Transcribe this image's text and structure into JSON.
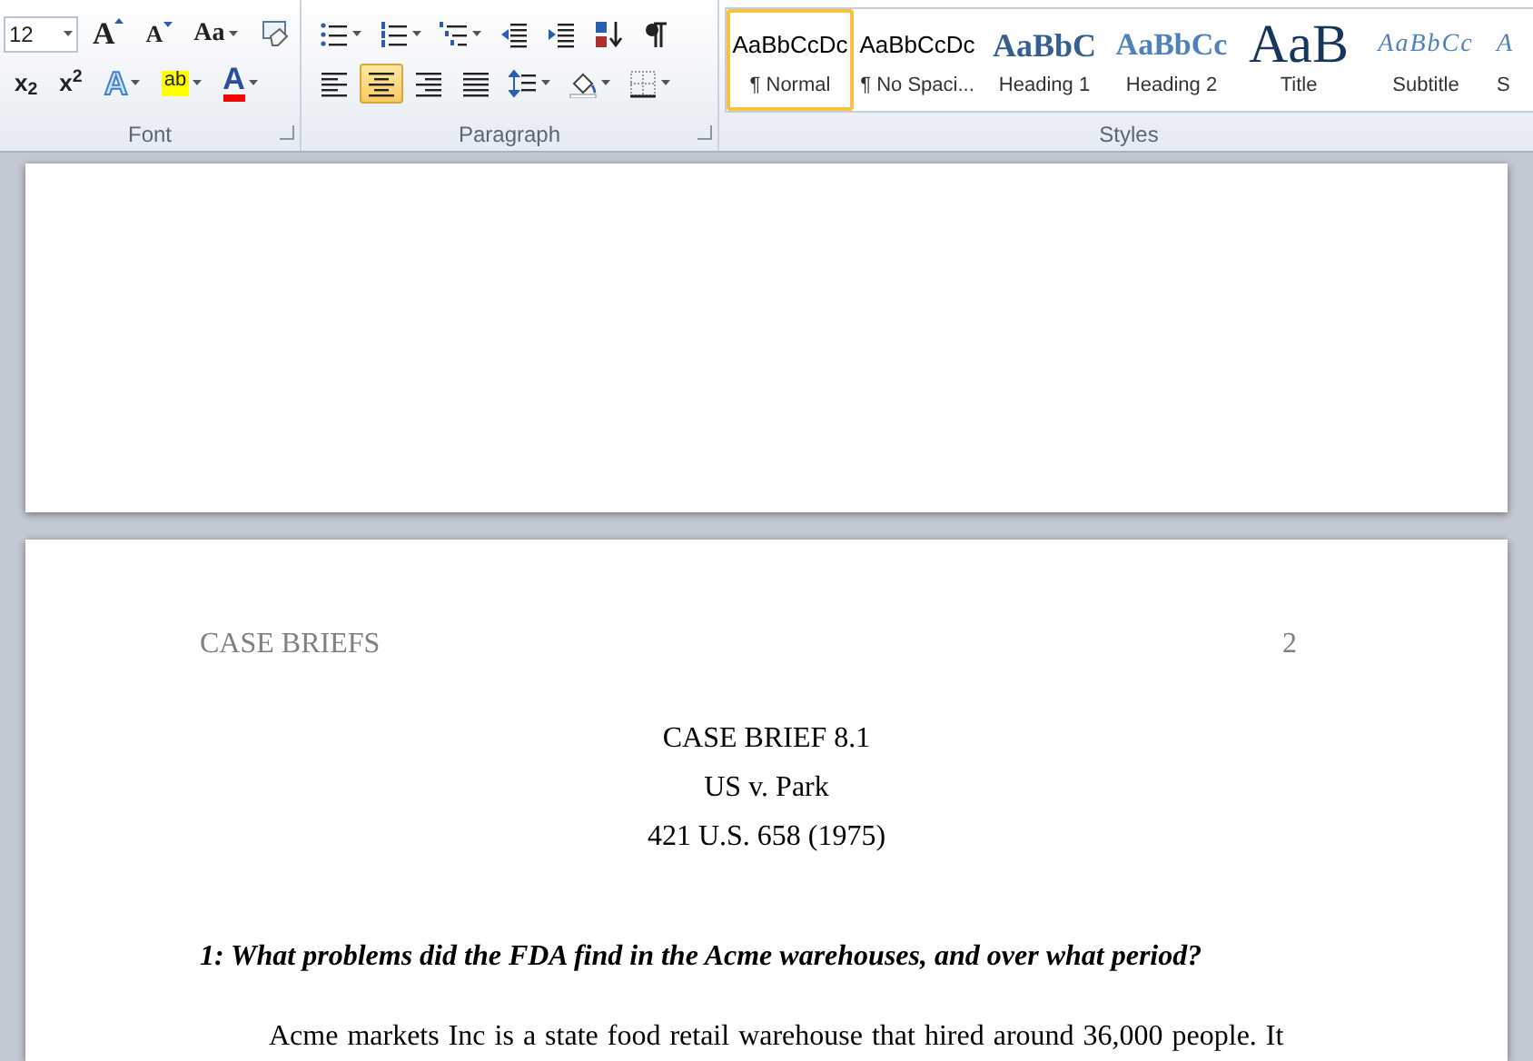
{
  "ribbon": {
    "font_group": {
      "label": "Font",
      "font_size": "12",
      "row1": [
        {
          "kind": "grow",
          "glyph": "A",
          "dropdown": false,
          "selected": false
        },
        {
          "kind": "shrink",
          "glyph": "A",
          "dropdown": false,
          "selected": false
        },
        {
          "kind": "case",
          "glyph": "Aa",
          "dropdown": true,
          "selected": false
        },
        {
          "kind": "clear",
          "dropdown": false,
          "selected": false
        }
      ],
      "row2": [
        {
          "kind": "subscript",
          "glyph": "x$_{2}$",
          "dropdown": false,
          "selected": false
        },
        {
          "kind": "superscript",
          "glyph": "x$^{2}$",
          "dropdown": false,
          "selected": false
        },
        {
          "kind": "effects",
          "glyph": "A",
          "dropdown": true,
          "selected": false
        },
        {
          "kind": "highlight",
          "glyph": "ab",
          "dropdown": true,
          "selected": false
        },
        {
          "kind": "fontcolor",
          "glyph": "A",
          "dropdown": true,
          "selected": false
        }
      ]
    },
    "paragraph_group": {
      "label": "Paragraph",
      "row1": [
        {
          "kind": "bullets",
          "dropdown": true,
          "selected": false
        },
        {
          "kind": "numbering",
          "dropdown": true,
          "selected": false
        },
        {
          "kind": "multilevel",
          "dropdown": true,
          "selected": false
        },
        {
          "kind": "outdent",
          "dropdown": false,
          "selected": false
        },
        {
          "kind": "indent",
          "dropdown": false,
          "selected": false
        },
        {
          "kind": "sort",
          "dropdown": false,
          "selected": false
        },
        {
          "kind": "pilcrow",
          "dropdown": false,
          "selected": false
        }
      ],
      "row2": [
        {
          "kind": "align-left",
          "dropdown": false,
          "selected": false
        },
        {
          "kind": "align-center",
          "dropdown": false,
          "selected": true
        },
        {
          "kind": "align-right",
          "dropdown": false,
          "selected": false
        },
        {
          "kind": "justify",
          "dropdown": false,
          "selected": false
        },
        {
          "kind": "spacing",
          "dropdown": true,
          "selected": false
        },
        {
          "kind": "shading",
          "dropdown": true,
          "selected": false
        },
        {
          "kind": "borders",
          "dropdown": true,
          "selected": false
        }
      ]
    },
    "styles_group": {
      "label": "Styles",
      "styles": [
        {
          "kind": "normal",
          "preview": "AaBbCcDc",
          "label": "¶ Normal",
          "selected": true
        },
        {
          "kind": "normal",
          "preview": "AaBbCcDc",
          "label": "¶ No Spaci...",
          "selected": false
        },
        {
          "kind": "heading1",
          "preview": "AaBbC",
          "label": "Heading 1",
          "selected": false
        },
        {
          "kind": "heading2",
          "preview": "AaBbCc",
          "label": "Heading 2",
          "selected": false
        },
        {
          "kind": "title",
          "preview": "AaB",
          "label": "Title",
          "selected": false
        },
        {
          "kind": "subtitle",
          "preview": "AaBbCc",
          "label": "Subtitle",
          "selected": false
        },
        {
          "kind": "subtitle",
          "preview": "A",
          "label": "S",
          "selected": false
        }
      ]
    }
  },
  "document": {
    "header_left": "CASE BRIEFS",
    "page_number": "2",
    "title_lines": [
      "CASE BRIEF 8.1",
      "US v. Park",
      "421 U.S. 658 (1975)"
    ],
    "question": "1: What problems did the FDA find in the Acme warehouses, and over what period?",
    "paragraph": "Acme markets Inc is a state food retail warehouse that hired around 36,000 people. It"
  }
}
